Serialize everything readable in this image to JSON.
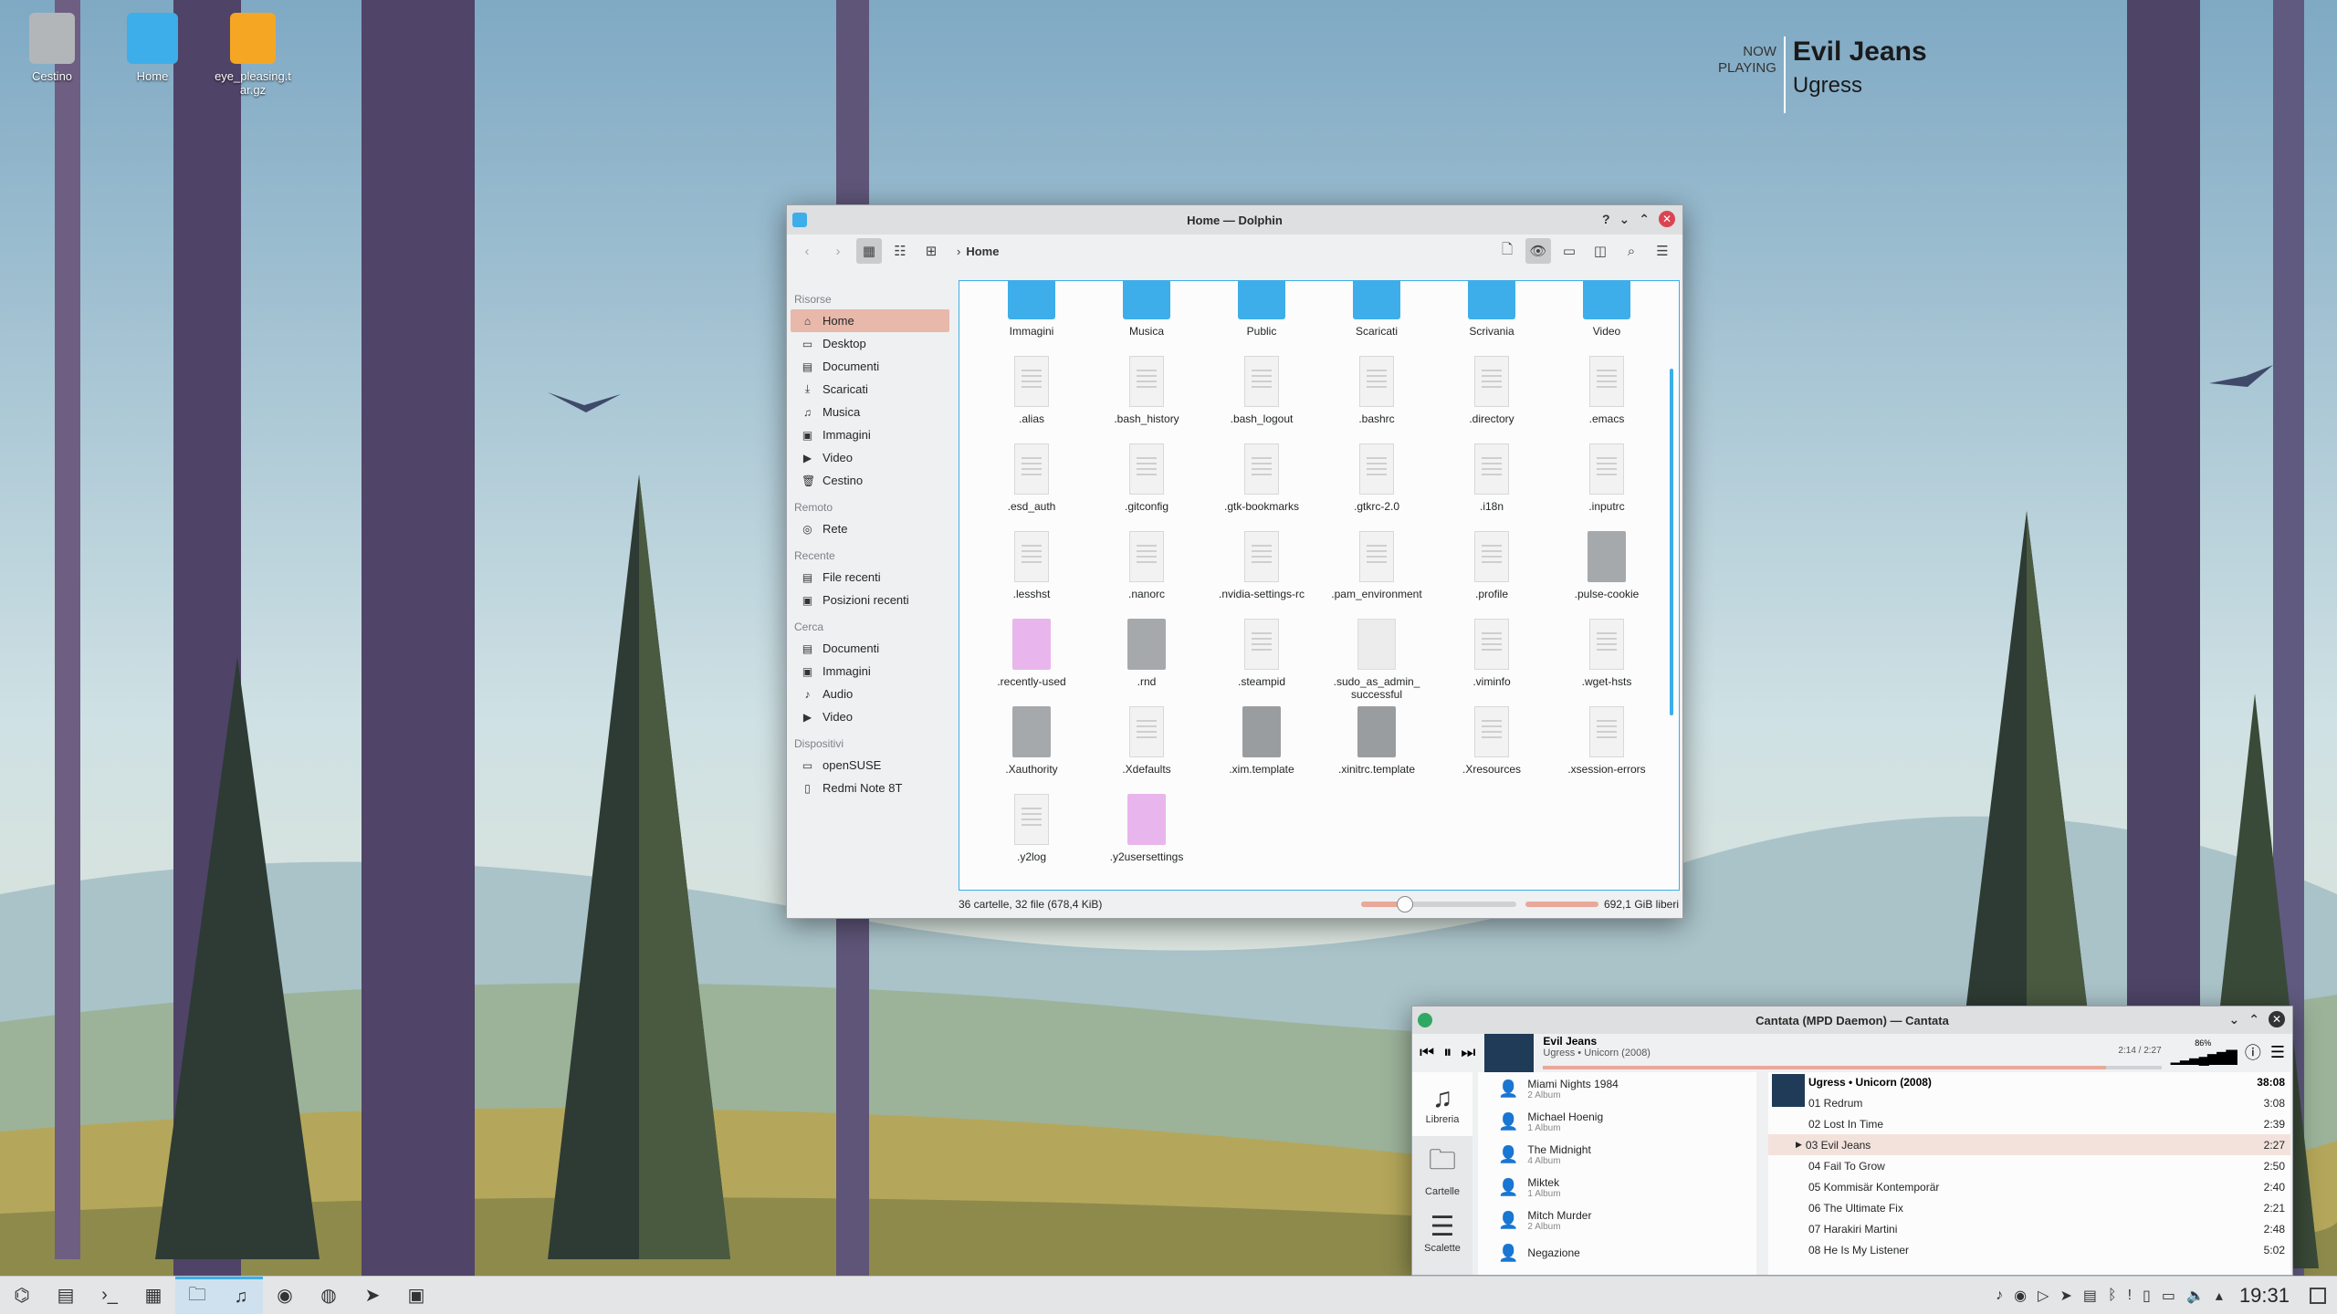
{
  "desktop": {
    "icons": [
      {
        "label": "Cestino",
        "icon": "trash-icon"
      },
      {
        "label": "Home",
        "icon": "home-folder-icon"
      },
      {
        "label": "eye_pleasing.tar.gz",
        "icon": "archive-icon"
      }
    ],
    "now_playing": {
      "label": "NOW\nPLAYING",
      "title": "Evil Jeans",
      "artist": "Ugress"
    }
  },
  "dolphin": {
    "title": "Home — Dolphin",
    "breadcrumb": "Home",
    "sidebar": {
      "sections": [
        {
          "title": "Risorse",
          "items": [
            {
              "label": "Home",
              "icon": "home-icon",
              "selected": true
            },
            {
              "label": "Desktop",
              "icon": "desktop-icon"
            },
            {
              "label": "Documenti",
              "icon": "documents-icon"
            },
            {
              "label": "Scaricati",
              "icon": "downloads-icon"
            },
            {
              "label": "Musica",
              "icon": "music-icon"
            },
            {
              "label": "Immagini",
              "icon": "pictures-icon"
            },
            {
              "label": "Video",
              "icon": "video-icon"
            },
            {
              "label": "Cestino",
              "icon": "trash-icon"
            }
          ]
        },
        {
          "title": "Remoto",
          "items": [
            {
              "label": "Rete",
              "icon": "network-icon"
            }
          ]
        },
        {
          "title": "Recente",
          "items": [
            {
              "label": "File recenti",
              "icon": "recent-files-icon"
            },
            {
              "label": "Posizioni recenti",
              "icon": "recent-locations-icon"
            }
          ]
        },
        {
          "title": "Cerca",
          "items": [
            {
              "label": "Documenti",
              "icon": "documents-icon"
            },
            {
              "label": "Immagini",
              "icon": "pictures-icon"
            },
            {
              "label": "Audio",
              "icon": "audio-icon"
            },
            {
              "label": "Video",
              "icon": "video-icon"
            }
          ]
        },
        {
          "title": "Dispositivi",
          "items": [
            {
              "label": "openSUSE",
              "icon": "drive-icon"
            },
            {
              "label": "Redmi Note 8T",
              "icon": "phone-icon"
            }
          ]
        }
      ]
    },
    "files": [
      {
        "name": "Immagini",
        "kind": "folder"
      },
      {
        "name": "Musica",
        "kind": "folder"
      },
      {
        "name": "Public",
        "kind": "folder"
      },
      {
        "name": "Scaricati",
        "kind": "folder"
      },
      {
        "name": "Scrivania",
        "kind": "folder"
      },
      {
        "name": "Video",
        "kind": "folder"
      },
      {
        "name": ".alias",
        "kind": "doc"
      },
      {
        "name": ".bash_history",
        "kind": "doc"
      },
      {
        "name": ".bash_logout",
        "kind": "doc"
      },
      {
        "name": ".bashrc",
        "kind": "doc"
      },
      {
        "name": ".directory",
        "kind": "doc"
      },
      {
        "name": ".emacs",
        "kind": "doc"
      },
      {
        "name": ".esd_auth",
        "kind": "doc"
      },
      {
        "name": ".gitconfig",
        "kind": "doc"
      },
      {
        "name": ".gtk-bookmarks",
        "kind": "doc"
      },
      {
        "name": ".gtkrc-2.0",
        "kind": "doc"
      },
      {
        "name": ".i18n",
        "kind": "doc"
      },
      {
        "name": ".inputrc",
        "kind": "doc"
      },
      {
        "name": ".lesshst",
        "kind": "doc"
      },
      {
        "name": ".nanorc",
        "kind": "doc"
      },
      {
        "name": ".nvidia-settings-rc",
        "kind": "doc"
      },
      {
        "name": ".pam_environment",
        "kind": "doc"
      },
      {
        "name": ".profile",
        "kind": "doc"
      },
      {
        "name": ".pulse-cookie",
        "kind": "unknown"
      },
      {
        "name": ".recently-used",
        "kind": "xml"
      },
      {
        "name": ".rnd",
        "kind": "unknown"
      },
      {
        "name": ".steampid",
        "kind": "doc"
      },
      {
        "name": ".sudo_as_admin_\nsuccessful",
        "kind": "blank"
      },
      {
        "name": ".viminfo",
        "kind": "doc"
      },
      {
        "name": ".wget-hsts",
        "kind": "doc"
      },
      {
        "name": ".Xauthority",
        "kind": "unknown"
      },
      {
        "name": ".Xdefaults",
        "kind": "doc"
      },
      {
        "name": ".xim.template",
        "kind": "script"
      },
      {
        "name": ".xinitrc.template",
        "kind": "script"
      },
      {
        "name": ".Xresources",
        "kind": "doc"
      },
      {
        "name": ".xsession-errors",
        "kind": "doc"
      },
      {
        "name": ".y2log",
        "kind": "doc"
      },
      {
        "name": ".y2usersettings",
        "kind": "xml"
      }
    ],
    "status": "36 cartelle, 32 file (678,4 KiB)",
    "free": "692,1 GiB liberi",
    "zoom_fraction": 0.28
  },
  "cantata": {
    "title": "Cantata (MPD Daemon) — Cantata",
    "track": "Evil Jeans",
    "sub": "Ugress • Unicorn (2008)",
    "time": "2:14 / 2:27",
    "progress": 0.91,
    "volume_label": "86%",
    "nav": [
      {
        "label": "Libreria",
        "icon": "music-note-icon"
      },
      {
        "label": "Cartelle",
        "icon": "folder-icon"
      },
      {
        "label": "Scalette",
        "icon": "list-icon"
      }
    ],
    "artists": [
      {
        "name": "Miami Nights 1984",
        "albums": "2 Album"
      },
      {
        "name": "Michael Hoenig",
        "albums": "1 Album"
      },
      {
        "name": "The Midnight",
        "albums": "4 Album"
      },
      {
        "name": "Miktek",
        "albums": "1 Album"
      },
      {
        "name": "Mitch Murder",
        "albums": "2 Album"
      },
      {
        "name": "Negazione",
        "albums": ""
      }
    ],
    "playlist_header": {
      "title": "Ugress • Unicorn (2008)",
      "total": "38:08"
    },
    "playlist": [
      {
        "t": "01 Redrum",
        "d": "3:08"
      },
      {
        "t": "02 Lost In Time",
        "d": "2:39"
      },
      {
        "t": "03 Evil Jeans",
        "d": "2:27",
        "cur": true
      },
      {
        "t": "04 Fail To Grow",
        "d": "2:50"
      },
      {
        "t": "05 Kommisär Kontemporär",
        "d": "2:40"
      },
      {
        "t": "06 The Ultimate Fix",
        "d": "2:21"
      },
      {
        "t": "07 Harakiri Martini",
        "d": "2:48"
      },
      {
        "t": "08 He Is My Listener",
        "d": "5:02"
      }
    ]
  },
  "taskbar": {
    "clock": "19:31"
  }
}
